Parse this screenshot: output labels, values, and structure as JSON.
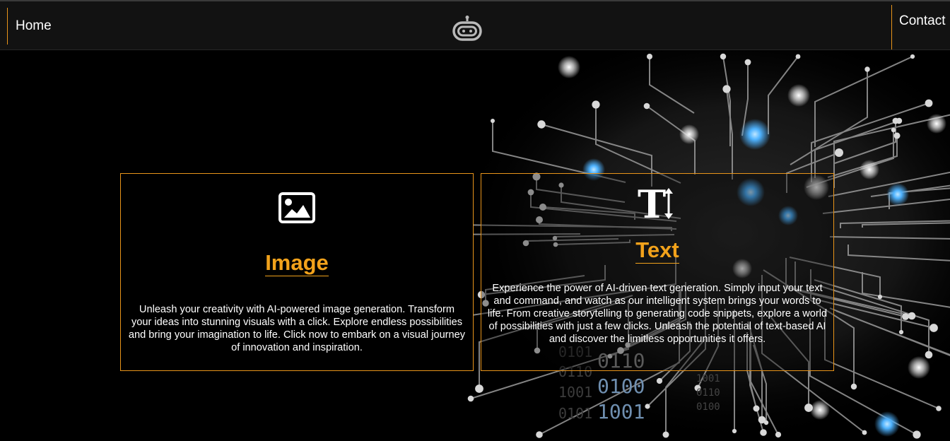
{
  "nav": {
    "home_label": "Home",
    "contact_label": "Contact",
    "logo_icon": "robot-head-icon"
  },
  "cards": [
    {
      "icon": "image-icon",
      "title": "Image",
      "description": "Unleash your creativity with AI-powered image generation. Transform your ideas into stunning visuals with a click. Explore endless possibilities and bring your imagination to life. Click now to embark on a visual journey of innovation and inspiration."
    },
    {
      "icon": "text-height-icon",
      "title": "Text",
      "description": "Experience the power of AI-driven text generation. Simply input your text and command, and watch as our intelligent system brings your words to life. From creative storytelling to generating code snippets, explore a world of possibilities with just a few clicks. Unleash the potential of text-based AI and discover the limitless opportunities it offers."
    }
  ],
  "background": {
    "binary_lines": [
      "0110",
      "0100",
      "1001",
      "0101",
      "0110",
      "1001",
      "1001",
      "0110",
      "0100",
      "0101"
    ]
  },
  "colors": {
    "accent": "#f2a21b",
    "border": "#e8941a",
    "navbar": "#121212",
    "background": "#000000",
    "circuit_glow": "#4fb3ff"
  }
}
